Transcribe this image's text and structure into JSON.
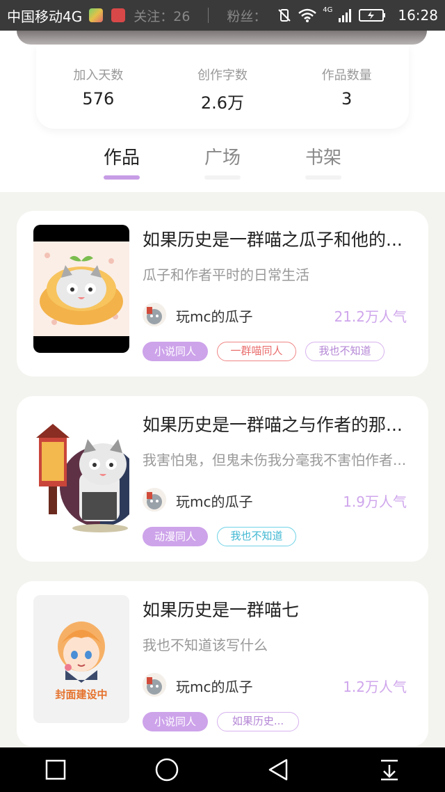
{
  "status_bar": {
    "carrier": "中国移动4G",
    "ghost_follow": "关注：26",
    "ghost_fans": "粉丝：",
    "network": "4G",
    "time": "16:28"
  },
  "stats": [
    {
      "label": "加入天数",
      "value": "576"
    },
    {
      "label": "创作字数",
      "value": "2.6万"
    },
    {
      "label": "作品数量",
      "value": "3"
    }
  ],
  "tabs": [
    {
      "label": "作品",
      "active": true
    },
    {
      "label": "广场",
      "active": false
    },
    {
      "label": "书架",
      "active": false
    }
  ],
  "works": [
    {
      "title": "如果历史是一群喵之瓜子和他的...",
      "desc": "瓜子和作者平时的日常生活",
      "author": "玩mc的瓜子",
      "popularity": "21.2万人气",
      "tags": [
        {
          "label": "小说同人",
          "style": "fill"
        },
        {
          "label": "一群喵同人",
          "style": "red"
        },
        {
          "label": "我也不知道",
          "style": "purple"
        }
      ]
    },
    {
      "title": "如果历史是一群喵之与作者的那...",
      "desc": "我害怕鬼，但鬼未伤我分毫我不害怕作者...",
      "author": "玩mc的瓜子",
      "popularity": "1.9万人气",
      "tags": [
        {
          "label": "动漫同人",
          "style": "fill"
        },
        {
          "label": "我也不知道",
          "style": "cyan"
        }
      ]
    },
    {
      "title": "如果历史是一群喵七",
      "desc": "我也不知道该写什么",
      "author": "玩mc的瓜子",
      "popularity": "1.2万人气",
      "cover_text": "封面建设中",
      "tags": [
        {
          "label": "小说同人",
          "style": "fill"
        },
        {
          "label": "如果历史...",
          "style": "purple2"
        }
      ]
    }
  ],
  "colors": {
    "accent": "#c79de6",
    "popularity": "#cfa6ec",
    "background": "#f3f3ef"
  }
}
